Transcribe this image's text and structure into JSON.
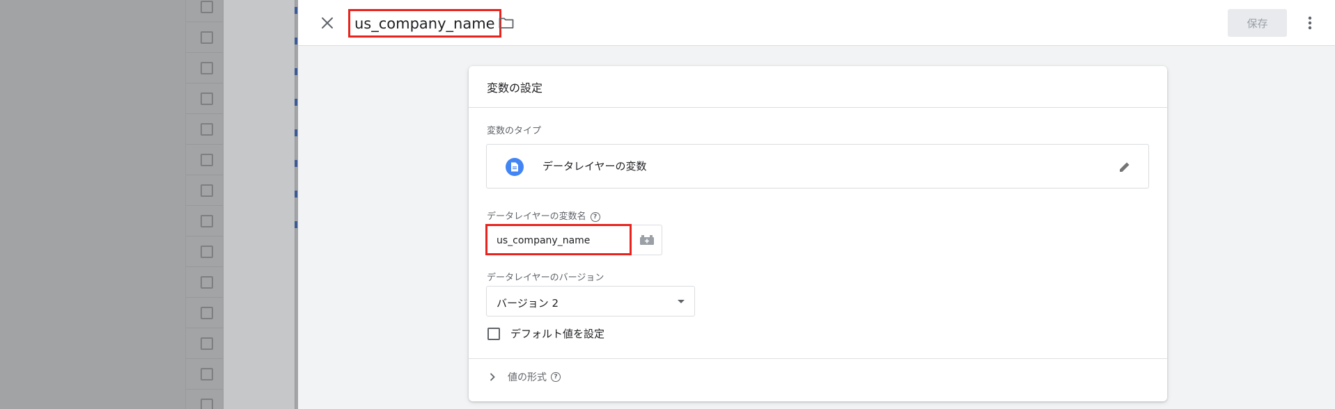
{
  "header": {
    "title": "us_company_name",
    "save_label": "保存"
  },
  "card": {
    "title": "変数の設定",
    "type_section_label": "変数のタイプ",
    "type_name": "データレイヤーの変数",
    "var_name_label": "データレイヤーの変数名",
    "var_name_value": "us_company_name",
    "version_label": "データレイヤーのバージョン",
    "version_value": "バージョン 2",
    "default_checkbox_label": "デフォルト値を設定",
    "format_label": "値の形式"
  },
  "icons": {
    "close": "close-icon",
    "folder": "folder-icon",
    "more": "more-vert-icon",
    "type": "document-icon",
    "edit": "pencil-icon",
    "help": "help-icon",
    "variable_picker": "variable-picker-icon",
    "caret": "chevron-down-icon",
    "expand": "chevron-right-icon"
  },
  "colors": {
    "highlight": "#e8231d",
    "accent": "#4285f4",
    "save_disabled_bg": "#e8eaed"
  }
}
